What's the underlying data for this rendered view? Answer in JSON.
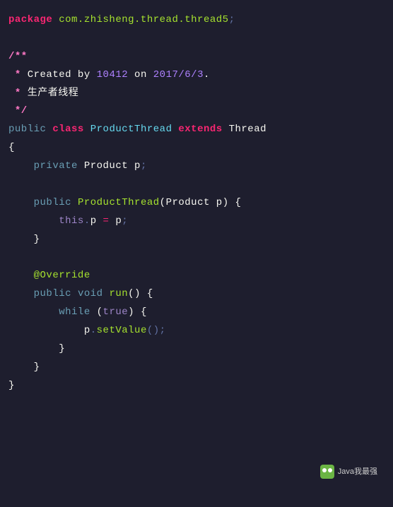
{
  "code": {
    "line1": {
      "package_kw": "package",
      "pkg": "com.zhisheng.thread.thread5",
      "semi": ";"
    },
    "line3": {
      "javadoc_open": "/**"
    },
    "line4": {
      "star": " *",
      "text1": " Created by ",
      "num1": "10412",
      "text2": " on ",
      "num2": "2017/6/3",
      "dot": "."
    },
    "line5": {
      "star": " *",
      "text": " 生产者线程"
    },
    "line6": {
      "javadoc_close": " */"
    },
    "line7": {
      "public_kw": "public",
      "class_kw": "class",
      "name": "ProductThread",
      "extends_kw": "extends",
      "parent": "Thread"
    },
    "line8": {
      "brace": "{"
    },
    "line9": {
      "private_kw": "private",
      "type": "Product",
      "var": "p",
      "semi": ";"
    },
    "line11": {
      "public_kw": "public",
      "name": "ProductThread",
      "lparen": "(",
      "param_type": "Product",
      "param_name": "p",
      "rparen": ")",
      "brace": " {"
    },
    "line12": {
      "this_kw": "this",
      "dot": ".",
      "field": "p",
      "eq": " = ",
      "val": "p",
      "semi": ";"
    },
    "line13": {
      "brace": "}"
    },
    "line15": {
      "anno": "@Override"
    },
    "line16": {
      "public_kw": "public",
      "void_kw": "void",
      "name": "run",
      "parens": "()",
      "brace": " {"
    },
    "line17": {
      "while_kw": "while",
      "lparen": " (",
      "true_kw": "true",
      "rparen": ")",
      "brace": " {"
    },
    "line18": {
      "obj": "p",
      "dot": ".",
      "method": "setValue",
      "call": "();"
    },
    "line19": {
      "brace": "}"
    },
    "line20": {
      "brace": "}"
    },
    "line21": {
      "brace": "}"
    }
  },
  "watermark": {
    "text": "Java我最强"
  }
}
